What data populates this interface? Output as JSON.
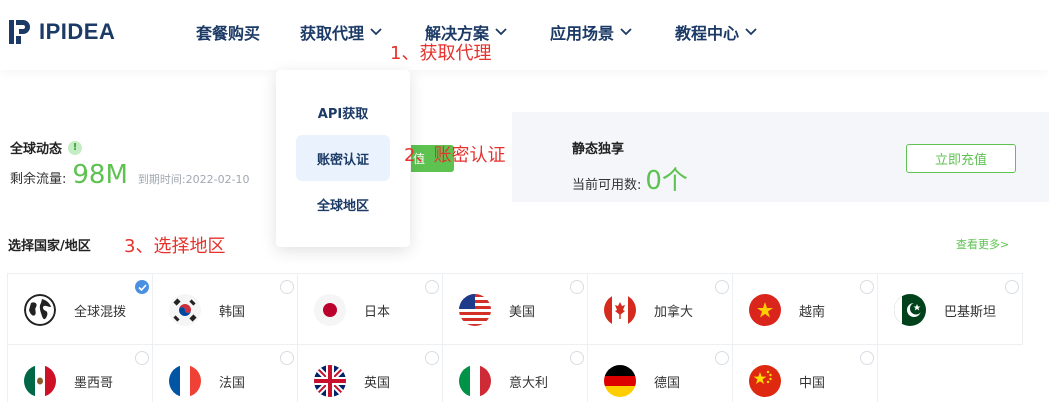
{
  "header": {
    "logo_text": "IPIDEA",
    "nav": [
      {
        "label": "套餐购买",
        "has_dropdown": false
      },
      {
        "label": "获取代理",
        "has_dropdown": true
      },
      {
        "label": "解决方案",
        "has_dropdown": true
      },
      {
        "label": "应用场景",
        "has_dropdown": true
      },
      {
        "label": "教程中心",
        "has_dropdown": true
      }
    ]
  },
  "dropdown": {
    "items": [
      {
        "label": "API获取",
        "active": false
      },
      {
        "label": "账密认证",
        "active": true
      },
      {
        "label": "全球地区",
        "active": false
      }
    ]
  },
  "annotations": {
    "step1": "1、获取代理",
    "step2": "2、账密认证",
    "step3": "3、选择地区"
  },
  "global_stats": {
    "title": "全球动态",
    "info_icon": "!",
    "remaining_label": "剩余流量:",
    "remaining_value": "98M",
    "expire": "到期时间:2022-02-10",
    "recharge_partial": "值"
  },
  "static": {
    "title": "静态独享",
    "available_label": "当前可用数:",
    "available_value": "0个",
    "recharge_button": "立即充值"
  },
  "regions": {
    "title": "选择国家/地区",
    "see_more": "查看更多>",
    "items": [
      {
        "label": "全球混拨",
        "icon": "globe-icon",
        "checked": true
      },
      {
        "label": "韩国",
        "icon": "flag-korea-icon",
        "checked": false
      },
      {
        "label": "日本",
        "icon": "flag-japan-icon",
        "checked": false
      },
      {
        "label": "美国",
        "icon": "flag-usa-icon",
        "checked": false
      },
      {
        "label": "加拿大",
        "icon": "flag-canada-icon",
        "checked": false
      },
      {
        "label": "越南",
        "icon": "flag-vietnam-icon",
        "checked": false
      },
      {
        "label": "巴基斯坦",
        "icon": "flag-pakistan-icon",
        "checked": false
      },
      {
        "label": "墨西哥",
        "icon": "flag-mexico-icon",
        "checked": false
      },
      {
        "label": "法国",
        "icon": "flag-france-icon",
        "checked": false
      },
      {
        "label": "英国",
        "icon": "flag-uk-icon",
        "checked": false
      },
      {
        "label": "意大利",
        "icon": "flag-italy-icon",
        "checked": false
      },
      {
        "label": "德国",
        "icon": "flag-germany-icon",
        "checked": false
      },
      {
        "label": "中国",
        "icon": "flag-china-icon",
        "checked": false
      }
    ]
  },
  "colors": {
    "brand_navy": "#1c3a66",
    "accent_green": "#5ec251",
    "annotation_red": "#e5322d",
    "selected_blue": "#4a90e2"
  }
}
